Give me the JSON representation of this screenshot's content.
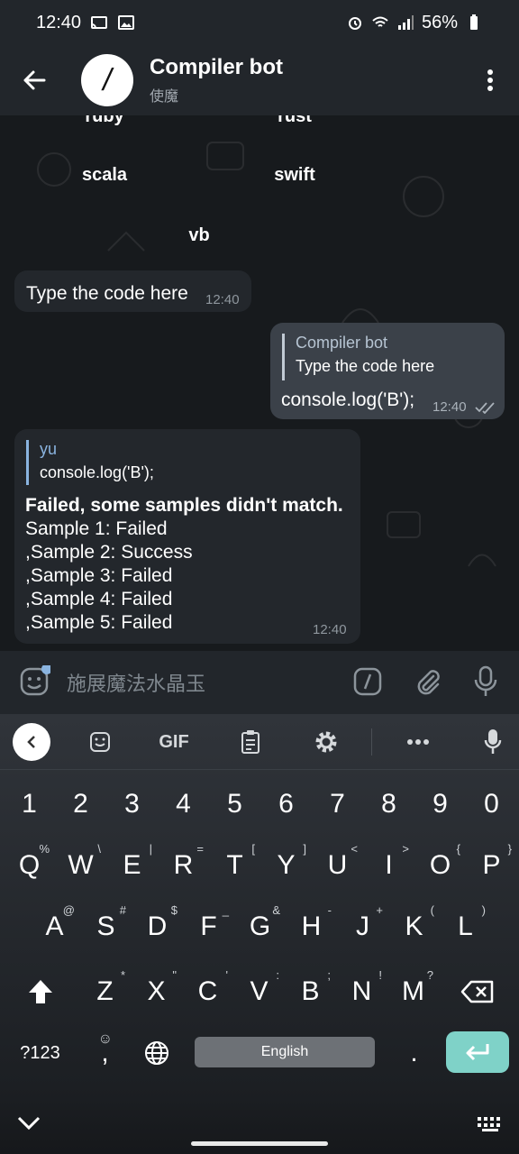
{
  "status": {
    "time": "12:40",
    "battery": "56%"
  },
  "header": {
    "title": "Compiler bot",
    "subtitle": "使魔",
    "avatar_glyph": "/"
  },
  "keyboard_buttons": [
    "ruby",
    "rust",
    "scala",
    "swift",
    "vb"
  ],
  "messages": [
    {
      "text": "Type the code here",
      "time": "12:40"
    },
    {
      "reply_name": "Compiler bot",
      "reply_text": "Type the code here",
      "text": "console.log('B');",
      "time": "12:40"
    },
    {
      "reply_name": "yu",
      "reply_text": "console.log('B');",
      "heading": "Failed, some samples didn't match.",
      "lines": [
        "Sample 1: Failed",
        ",Sample 2: Success",
        ",Sample 3: Failed",
        ",Sample 4: Failed",
        ",Sample 5: Failed"
      ],
      "time": "12:40"
    }
  ],
  "input": {
    "placeholder": "施展魔法水晶玉"
  },
  "kb_toolbar": {
    "gif": "GIF"
  },
  "keys": {
    "row_numbers": [
      "1",
      "2",
      "3",
      "4",
      "5",
      "6",
      "7",
      "8",
      "9",
      "0"
    ],
    "row1": [
      {
        "k": "Q",
        "s": "%"
      },
      {
        "k": "W",
        "s": "\\"
      },
      {
        "k": "E",
        "s": "|"
      },
      {
        "k": "R",
        "s": "="
      },
      {
        "k": "T",
        "s": "["
      },
      {
        "k": "Y",
        "s": "]"
      },
      {
        "k": "U",
        "s": "<"
      },
      {
        "k": "I",
        "s": ">"
      },
      {
        "k": "O",
        "s": "{"
      },
      {
        "k": "P",
        "s": "}"
      }
    ],
    "row2": [
      {
        "k": "A",
        "s": "@"
      },
      {
        "k": "S",
        "s": "#"
      },
      {
        "k": "D",
        "s": "$"
      },
      {
        "k": "F",
        "s": "_"
      },
      {
        "k": "G",
        "s": "&"
      },
      {
        "k": "H",
        "s": "-"
      },
      {
        "k": "J",
        "s": "+"
      },
      {
        "k": "K",
        "s": "("
      },
      {
        "k": "L",
        "s": ")"
      }
    ],
    "row3": [
      {
        "k": "Z",
        "s": "*"
      },
      {
        "k": "X",
        "s": "\""
      },
      {
        "k": "C",
        "s": "'"
      },
      {
        "k": "V",
        "s": ":"
      },
      {
        "k": "B",
        "s": ";"
      },
      {
        "k": "N",
        "s": "!"
      },
      {
        "k": "M",
        "s": "?"
      }
    ],
    "symbols_label": "?123",
    "comma": ",",
    "space_label": "English",
    "period": "."
  },
  "colors": {
    "accent": "#7fd2c8",
    "chat_bg": "#171a1d",
    "bubble_in": "#23272c",
    "bubble_out": "#3b4149"
  }
}
